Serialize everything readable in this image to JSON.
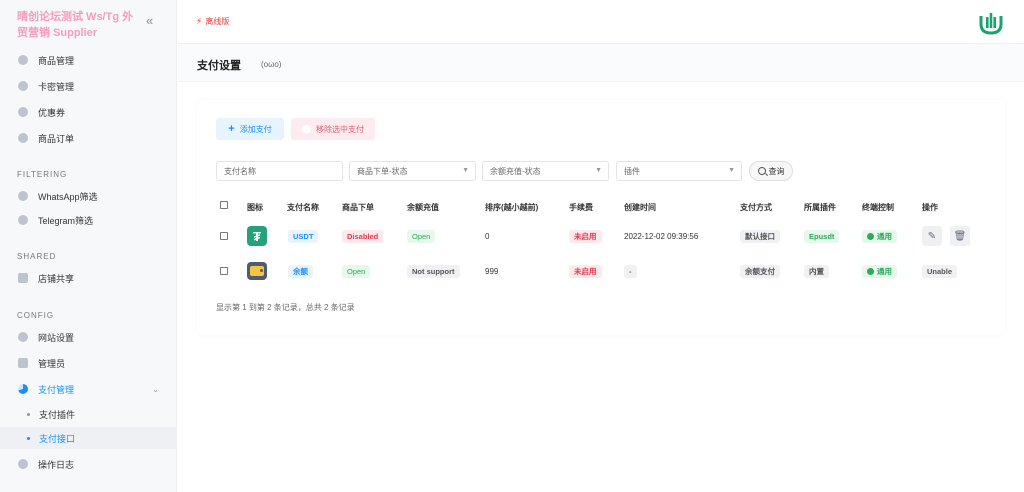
{
  "sidebar": {
    "brand": "晴创论坛测试 Ws/Tg 外贸营销 Supplier",
    "collapse_icon": "double-chevron-left-icon",
    "items": [
      {
        "label": "商品管理",
        "icon": "box-icon"
      },
      {
        "label": "卡密管理",
        "icon": "gear-icon"
      },
      {
        "label": "优惠券",
        "icon": "ticket-icon"
      },
      {
        "label": "商品订单",
        "icon": "order-icon"
      }
    ],
    "section_filtering": "FILTERING",
    "filtering_items": [
      {
        "label": "WhatsApp筛选",
        "icon": "send-icon"
      },
      {
        "label": "Telegram筛选",
        "icon": "send-icon"
      }
    ],
    "section_shared": "SHARED",
    "shared_items": [
      {
        "label": "店铺共享",
        "icon": "cross-tools-icon"
      }
    ],
    "section_config": "CONFIG",
    "config_items": [
      {
        "label": "网站设置",
        "icon": "gear-icon"
      },
      {
        "label": "管理员",
        "icon": "users-icon"
      },
      {
        "label": "支付管理",
        "icon": "pie-icon"
      }
    ],
    "payment_sub": [
      {
        "label": "支付插件"
      },
      {
        "label": "支付接口"
      }
    ],
    "last_item": {
      "label": "操作日志",
      "icon": "log-icon"
    }
  },
  "topbar": {
    "offline_label": "离线版",
    "logo_color": "#1aa36a"
  },
  "page": {
    "title": "支付设置",
    "face": "(oωo)"
  },
  "toolbar": {
    "add_label": "添加支付",
    "remove_label": "移除选中支付"
  },
  "filters": {
    "name_placeholder": "支付名称",
    "order_status": "商品下单-状态",
    "recharge_status": "余额充值-状态",
    "plugin": "插件",
    "search_label": "查询"
  },
  "table": {
    "headers": [
      "图标",
      "支付名称",
      "商品下单",
      "余额充值",
      "排序(越小越前)",
      "手续费",
      "创建时间",
      "支付方式",
      "所属插件",
      "终端控制",
      "操作"
    ],
    "rows": [
      {
        "icon": "tether-icon",
        "name": "USDT",
        "order": "Disabled",
        "recharge": "Open",
        "sort": "0",
        "fee": "未启用",
        "created": "2022-12-02 09:39:56",
        "method": "默认接口",
        "plugin": "Epusdt",
        "terminal": "通用"
      },
      {
        "icon": "wallet-icon",
        "name": "余额",
        "order": "Open",
        "recharge": "Not support",
        "sort": "999",
        "fee": "未启用",
        "created": "-",
        "method": "余额支付",
        "plugin": "内置",
        "terminal": "通用",
        "action": "Unable"
      }
    ]
  },
  "pager": {
    "summary": "显示第 1 到第 2 条记录，总共 2 条记录"
  },
  "colors": {
    "accent": "#1890ff",
    "danger": "#e53950",
    "success": "#2eaa5a"
  }
}
